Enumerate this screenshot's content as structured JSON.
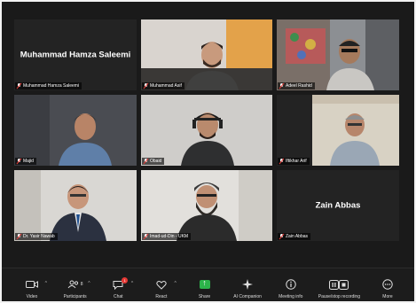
{
  "participants": [
    {
      "name": "Muhammad Hamza Saleemi",
      "display": "Muhammad Hamza Saleemi",
      "video": false
    },
    {
      "name": "Muhammad Asif",
      "video": true
    },
    {
      "name": "Adeel Rashid",
      "video": true
    },
    {
      "name": "Majid",
      "video": true
    },
    {
      "name": "Obaid",
      "video": true
    },
    {
      "name": "Iftikhar Arif",
      "video": true
    },
    {
      "name": "Dr. Yasir Nawab",
      "video": true
    },
    {
      "name": "Imad-ud-Din - UKM",
      "video": true
    },
    {
      "name": "Zain Abbas",
      "display": "Zain Abbas",
      "video": false
    }
  ],
  "toolbar": {
    "video": "Video",
    "participants": "Participants",
    "participants_count": "8",
    "chat": "Chat",
    "chat_badge": "1",
    "react": "React",
    "share": "Share",
    "ai_companion": "AI Companion",
    "meeting_info": "Meeting info",
    "pause_recording": "Pause/stop recording",
    "more": "More"
  },
  "colors": {
    "share_green": "#2cb34a",
    "muted_red": "#e53935",
    "background": "#1a1a1a"
  }
}
